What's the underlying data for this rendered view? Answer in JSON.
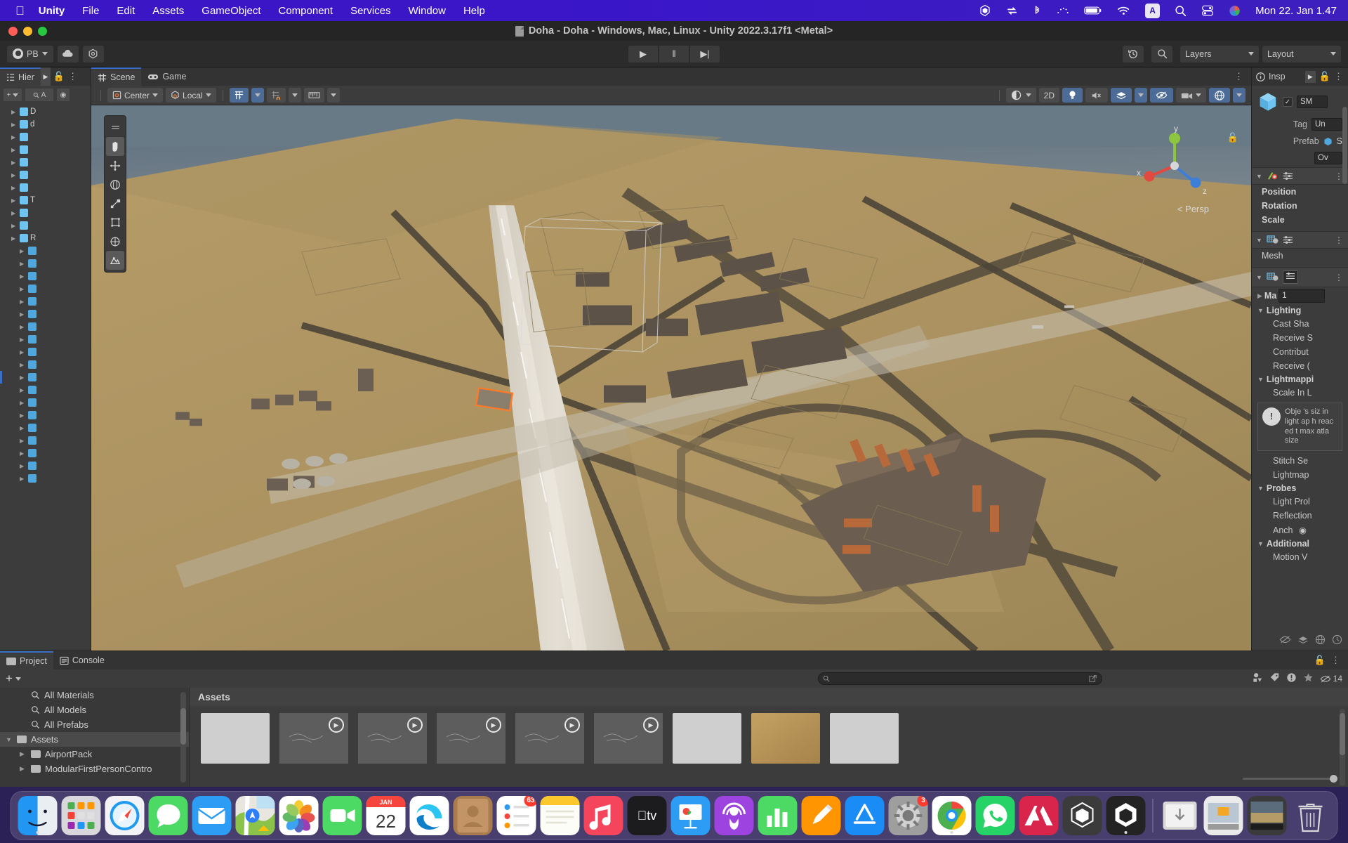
{
  "menubar": {
    "apple": "apple-logo",
    "items": [
      {
        "label": "Unity",
        "bold": true
      },
      {
        "label": "File",
        "bold": false
      },
      {
        "label": "Edit",
        "bold": false
      },
      {
        "label": "Assets",
        "bold": false
      },
      {
        "label": "GameObject",
        "bold": false
      },
      {
        "label": "Component",
        "bold": false
      },
      {
        "label": "Services",
        "bold": false
      },
      {
        "label": "Window",
        "bold": false
      },
      {
        "label": "Help",
        "bold": false
      }
    ],
    "status_icons": [
      "unity-icon",
      "bluetooth-file-icon",
      "bluetooth-icon",
      "dots-icon",
      "battery-icon",
      "wifi-icon",
      "input-source-icon",
      "spotlight-search-icon",
      "control-center-icon",
      "siri-icon"
    ],
    "input_source": "A",
    "clock": "Mon 22. Jan  1.47"
  },
  "window": {
    "title": "Doha - Doha - Windows, Mac, Linux - Unity 2022.3.17f1 <Metal>",
    "traffic_lights": [
      "close-button",
      "minimize-button",
      "zoom-button"
    ]
  },
  "toolbar": {
    "account_label": "PB",
    "cloud_icon": "cloud-icon",
    "settings_icon": "gear-icon",
    "play": "▶",
    "pause": "‖",
    "step": "▶|",
    "history_icon": "undo-history-icon",
    "search_icon": "search-icon",
    "layers_label": "Layers",
    "layout_label": "Layout"
  },
  "hierarchy": {
    "tab_label": "Hier",
    "lock_icon": "lock-icon",
    "menu_icon": "kebab-menu-icon",
    "add_label": "+",
    "search_label": "A",
    "rows": [
      {
        "label": "D",
        "depth": 1,
        "icon": "cube-icon",
        "sel": false
      },
      {
        "label": "d",
        "depth": 1,
        "icon": "cube-icon",
        "sel": false
      },
      {
        "label": "",
        "depth": 1,
        "icon": "cube-icon",
        "sel": false
      },
      {
        "label": "",
        "depth": 1,
        "icon": "cube-icon",
        "sel": false
      },
      {
        "label": "",
        "depth": 1,
        "icon": "cube-icon",
        "sel": false
      },
      {
        "label": "",
        "depth": 1,
        "icon": "cube-icon",
        "sel": false
      },
      {
        "label": "",
        "depth": 1,
        "icon": "cube-icon",
        "sel": false
      },
      {
        "label": "T",
        "depth": 1,
        "icon": "cube-icon",
        "sel": false
      },
      {
        "label": "",
        "depth": 1,
        "icon": "cube-icon",
        "sel": false
      },
      {
        "label": "",
        "depth": 1,
        "icon": "cube-icon",
        "sel": false
      },
      {
        "label": "R",
        "depth": 1,
        "icon": "cube-icon",
        "sel": false
      },
      {
        "label": "",
        "depth": 2,
        "icon": "cube-icon",
        "sel": false
      },
      {
        "label": "",
        "depth": 2,
        "icon": "cube-icon",
        "sel": false
      },
      {
        "label": "",
        "depth": 2,
        "icon": "cube-icon",
        "sel": false
      },
      {
        "label": "",
        "depth": 2,
        "icon": "cube-icon",
        "sel": false
      },
      {
        "label": "",
        "depth": 2,
        "icon": "cube-icon",
        "sel": false
      },
      {
        "label": "",
        "depth": 2,
        "icon": "cube-icon",
        "sel": false
      },
      {
        "label": "",
        "depth": 2,
        "icon": "cube-icon",
        "sel": false
      },
      {
        "label": "",
        "depth": 2,
        "icon": "cube-icon",
        "sel": false
      },
      {
        "label": "",
        "depth": 2,
        "icon": "cube-icon",
        "sel": false
      },
      {
        "label": "",
        "depth": 2,
        "icon": "cube-icon",
        "sel": false
      },
      {
        "label": "",
        "depth": 2,
        "icon": "cube-icon",
        "sel": true
      },
      {
        "label": "",
        "depth": 2,
        "icon": "cube-icon",
        "sel": false
      },
      {
        "label": "",
        "depth": 2,
        "icon": "cube-icon",
        "sel": false
      },
      {
        "label": "",
        "depth": 2,
        "icon": "cube-icon",
        "sel": false
      },
      {
        "label": "",
        "depth": 2,
        "icon": "cube-icon",
        "sel": false
      },
      {
        "label": "",
        "depth": 2,
        "icon": "cube-icon",
        "sel": false
      },
      {
        "label": "",
        "depth": 2,
        "icon": "cube-icon",
        "sel": false
      },
      {
        "label": "",
        "depth": 2,
        "icon": "cube-icon",
        "sel": false
      },
      {
        "label": "",
        "depth": 2,
        "icon": "cube-icon",
        "sel": false
      }
    ]
  },
  "scene": {
    "tabs": [
      {
        "label": "Scene",
        "icon": "grid-icon",
        "active": true
      },
      {
        "label": "Game",
        "icon": "gamepad-icon",
        "active": false
      }
    ],
    "menu_icon": "kebab-menu-icon",
    "pivot_label": "Center",
    "space_label": "Local",
    "tools": [
      "hand-tool",
      "move-tool",
      "rotate-tool",
      "scale-tool",
      "rect-tool",
      "transform-tool",
      "custom-tool"
    ],
    "snap_icons": [
      "grid-snap-icon",
      "magnet-snap-icon",
      "ruler-snap-icon"
    ],
    "right_icons": [
      "shading-mode-icon",
      "2d-toggle",
      "lighting-icon",
      "audio-mute-icon",
      "effects-icon",
      "hidden-objects-icon",
      "camera-icon",
      "gizmos-icon"
    ],
    "twod_label": "2D",
    "perspective_label": "Persp",
    "gizmo_axes": {
      "x": "x",
      "y": "y",
      "z": "z"
    }
  },
  "inspector": {
    "tab_label": "Insp",
    "lock_icon": "lock-icon",
    "menu_icon": "kebab-menu-icon",
    "object_icon": "cube-icon",
    "enabled": true,
    "name_value": "SM",
    "tag_label": "Tag",
    "tag_value": "Un",
    "prefab_label": "Prefab",
    "prefab_value": "S",
    "overrides_label": "Ov",
    "transform": {
      "icon": "transform-icon",
      "rows": [
        "Position",
        "Rotation",
        "Scale"
      ]
    },
    "mesh_filter": {
      "icon": "mesh-filter-icon",
      "label": "Mesh"
    },
    "mesh_renderer": {
      "icon": "mesh-renderer-icon",
      "materials_label": "Ma",
      "materials_count": "1",
      "lighting_label": "Lighting",
      "lighting_props": [
        "Cast Sha",
        "Receive S",
        "Contribut",
        "Receive ("
      ],
      "lightmapping_label": "Lightmappi",
      "lightmapping_props": [
        "Scale In L"
      ],
      "warning_text": "Obje 's siz in light ap h reac ed t max atla size",
      "stitch_label": "Stitch Se",
      "lightmap_label": "Lightmap",
      "probes_label": "Probes",
      "probes_props": [
        "Light Prol",
        "Reflection",
        "Anch"
      ],
      "additional_label": "Additional",
      "motion_label": "Motion V"
    },
    "footer_icons": [
      "hidden-icon",
      "layers-icon",
      "globe-icon",
      "clock-icon"
    ]
  },
  "project": {
    "tabs": [
      {
        "label": "Project",
        "icon": "folder-icon",
        "active": true
      },
      {
        "label": "Console",
        "icon": "console-icon",
        "active": false
      }
    ],
    "add_label": "+",
    "lock_icon": "lock-icon",
    "menu_icon": "kebab-menu-icon",
    "search_placeholder": "",
    "search_icon": "search-icon",
    "filter_icons": [
      "type-filter-icon",
      "label-filter-icon",
      "warning-filter-icon",
      "favorite-filter-icon"
    ],
    "hidden_count": "14",
    "tree": [
      {
        "label": "All Materials",
        "icon": "search-icon",
        "indent": 1,
        "sel": false,
        "arrow": false
      },
      {
        "label": "All Models",
        "icon": "search-icon",
        "indent": 1,
        "sel": false,
        "arrow": false
      },
      {
        "label": "All Prefabs",
        "icon": "search-icon",
        "indent": 1,
        "sel": false,
        "arrow": false
      },
      {
        "label": "Assets",
        "icon": "folder-icon",
        "indent": 0,
        "sel": true,
        "arrow": true
      },
      {
        "label": "AirportPack",
        "icon": "folder-icon",
        "indent": 1,
        "sel": false,
        "arrow": true
      },
      {
        "label": "ModularFirstPersonContro",
        "icon": "folder-icon",
        "indent": 1,
        "sel": false,
        "arrow": true
      }
    ],
    "assets_header": "Assets",
    "thumbnails": [
      {
        "kind": "pale",
        "play": false
      },
      {
        "kind": "dark",
        "play": true
      },
      {
        "kind": "dark",
        "play": true
      },
      {
        "kind": "dark",
        "play": true
      },
      {
        "kind": "dark",
        "play": true
      },
      {
        "kind": "dark",
        "play": true
      },
      {
        "kind": "pale",
        "play": false
      },
      {
        "kind": "sand",
        "play": false
      },
      {
        "kind": "pale",
        "play": false
      }
    ]
  },
  "dock": {
    "apps": [
      {
        "name": "finder",
        "badge": "",
        "running": true
      },
      {
        "name": "launchpad",
        "badge": "",
        "running": false
      },
      {
        "name": "safari",
        "badge": "",
        "running": false
      },
      {
        "name": "messages",
        "badge": "",
        "running": false
      },
      {
        "name": "mail",
        "badge": "",
        "running": false
      },
      {
        "name": "maps",
        "badge": "",
        "running": false
      },
      {
        "name": "photos",
        "badge": "",
        "running": false
      },
      {
        "name": "facetime",
        "badge": "",
        "running": false
      },
      {
        "name": "calendar",
        "badge": "",
        "running": false,
        "month": "JAN",
        "day": "22"
      },
      {
        "name": "edge",
        "badge": "",
        "running": false
      },
      {
        "name": "contacts",
        "badge": "",
        "running": false
      },
      {
        "name": "reminders",
        "badge": "63",
        "running": false
      },
      {
        "name": "notes",
        "badge": "",
        "running": false
      },
      {
        "name": "music",
        "badge": "",
        "running": false
      },
      {
        "name": "appletv",
        "badge": "",
        "running": false
      },
      {
        "name": "keynote",
        "badge": "",
        "running": false
      },
      {
        "name": "podcasts",
        "badge": "",
        "running": false
      },
      {
        "name": "numbers",
        "badge": "",
        "running": false
      },
      {
        "name": "pages",
        "badge": "",
        "running": false
      },
      {
        "name": "appstore",
        "badge": "",
        "running": false
      },
      {
        "name": "system-settings",
        "badge": "3",
        "running": false
      },
      {
        "name": "chrome",
        "badge": "",
        "running": true
      },
      {
        "name": "whatsapp",
        "badge": "",
        "running": false
      },
      {
        "name": "adobe",
        "badge": "",
        "running": false
      },
      {
        "name": "unity-hub",
        "badge": "",
        "running": false
      },
      {
        "name": "unity-editor",
        "badge": "",
        "running": true
      },
      {
        "name": "downloads-stack",
        "badge": "",
        "running": false
      },
      {
        "name": "screenshot",
        "badge": "",
        "running": false
      },
      {
        "name": "preview-window",
        "badge": "",
        "running": false
      },
      {
        "name": "trash",
        "badge": "",
        "running": false
      }
    ]
  },
  "colors": {
    "menubar_purple": "#3a16c4",
    "unity_panel": "#3c3c3c",
    "accent_blue": "#4c6b96",
    "selection_orange": "#ff7a29",
    "terrain_sand": "#b79a63"
  }
}
